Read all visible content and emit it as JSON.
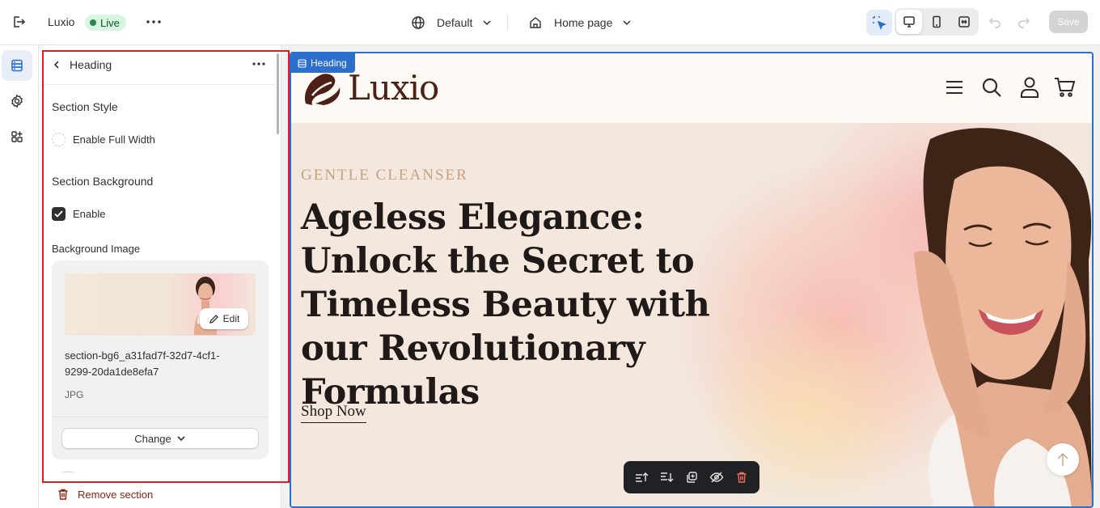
{
  "topbar": {
    "app_name": "Luxio",
    "status": "Live",
    "theme": "Default",
    "page": "Home page",
    "save_label": "Save"
  },
  "rail": {
    "items": [
      "sections-icon",
      "settings-gear-icon",
      "apps-icon"
    ]
  },
  "panel": {
    "title": "Heading",
    "section_style": {
      "label": "Section Style",
      "full_width_label": "Enable Full Width",
      "full_width_checked": false
    },
    "section_background": {
      "label": "Section Background",
      "enable_label": "Enable",
      "enabled": true
    },
    "background_image": {
      "label": "Background Image",
      "edit_label": "Edit",
      "file_name": "section-bg6_a31fad7f-32d7-4cf1-9299-20da1de8efa7",
      "file_type": "JPG",
      "change_label": "Change"
    },
    "remove_label": "Remove section"
  },
  "preview": {
    "selected_tag": "Heading",
    "brand": "Luxio",
    "eyebrow": "GENTLE CLEANSER",
    "headline": "Ageless Elegance: Unlock the Secret to Timeless Beauty with our Revolutionary Formulas",
    "cta": "Shop Now"
  },
  "colors": {
    "accent": "#2c6ecb",
    "highlight": "#e11d24",
    "brand": "#4d1f15",
    "eyebrow": "#c7a27a",
    "live_badge": "#d7f5df"
  }
}
